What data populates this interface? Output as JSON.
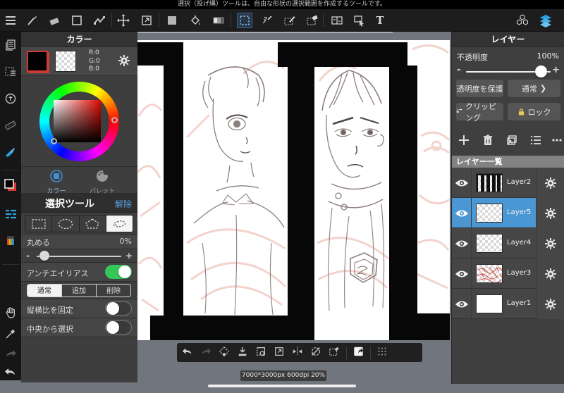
{
  "header": {
    "tooltip": "選択（投げ縄）ツールは、自由な形状の選択範囲を作成するツールです。",
    "text_tool_glyph": "T"
  },
  "color_panel": {
    "title": "カラー",
    "rgb": {
      "r": "R:0",
      "g": "G:0",
      "b": "B:0"
    },
    "tab_color": "カラー",
    "tab_palette": "パレット"
  },
  "selection_panel": {
    "title": "選択ツール",
    "clear": "解除",
    "round_label": "丸める",
    "round_value": "0%",
    "antialias_label": "アンチエイリアス",
    "mode_normal": "通常",
    "mode_add": "追加",
    "mode_delete": "削除",
    "fixed_ratio_label": "縦横比を固定",
    "from_center_label": "中央から選択",
    "minus": "-",
    "plus": "+"
  },
  "layers_panel": {
    "title": "レイヤー",
    "opacity_label": "不透明度",
    "opacity_value": "100%",
    "minus": "-",
    "plus": "+",
    "protect_alpha": "透明度を保護",
    "blend_mode": "通常",
    "blend_chevron": "❯",
    "clipping": "クリッピング",
    "lock": "ロック",
    "list_header": "レイヤー一覧",
    "layers": [
      {
        "name": "Layer2",
        "thumb": "panel-bars",
        "selected": false
      },
      {
        "name": "Layer5",
        "thumb": "transparent",
        "selected": true
      },
      {
        "name": "Layer4",
        "thumb": "transparent",
        "selected": false
      },
      {
        "name": "Layer3",
        "thumb": "red-sketch",
        "selected": false
      },
      {
        "name": "Layer1",
        "thumb": "white",
        "selected": false
      }
    ]
  },
  "canvas": {
    "size_info": "7000*3000px 600dpi 20%"
  }
}
